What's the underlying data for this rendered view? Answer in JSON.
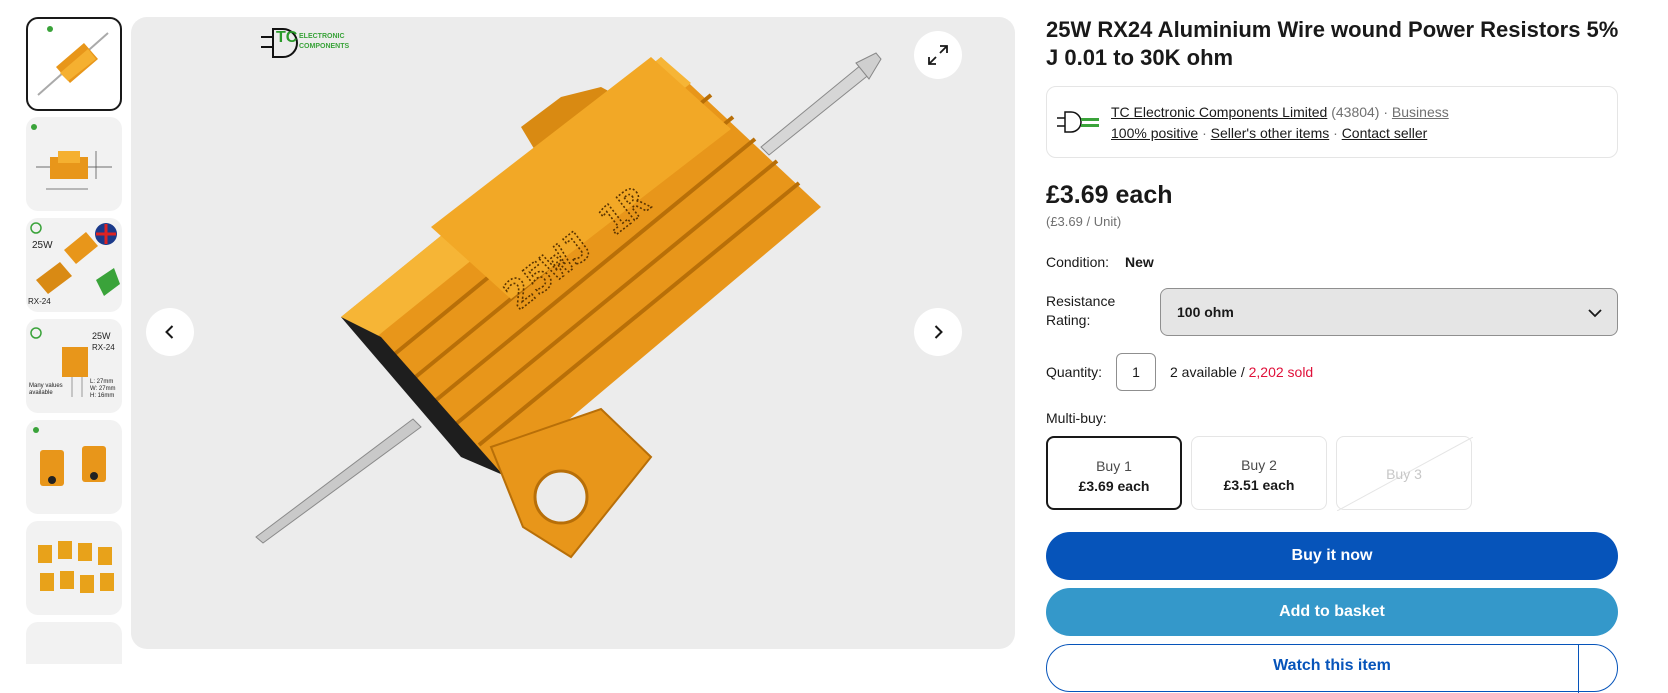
{
  "product": {
    "title": "25W RX24 Aluminium Wire wound Power Resistors 5% J 0.01 to 30K ohm"
  },
  "gallery": {
    "logo_line1": "ELECTRONIC",
    "logo_line2": "COMPONENTS",
    "logo_mark": "TC",
    "resistor_marking": "25WJ 1R",
    "thumbs": [
      {
        "caption": ""
      },
      {
        "caption": ""
      },
      {
        "caption": "25W",
        "caption2": "RX-24"
      },
      {
        "caption": "25W",
        "caption2": "RX-24",
        "caption3": "Many values available",
        "dims": "L: 27mm W: 27mm H: 16mm"
      },
      {
        "caption": ""
      },
      {
        "caption": ""
      }
    ]
  },
  "seller": {
    "name": "TC Electronic Components Limited",
    "feedback_count": "(43804)",
    "dot": "·",
    "type": "Business",
    "positive": "100% positive",
    "other_items": "Seller's other items",
    "contact": "Contact seller"
  },
  "price": {
    "main": "£3.69 each",
    "unit": "(£3.69 / Unit)"
  },
  "condition": {
    "label": "Condition:",
    "value": "New"
  },
  "resistance": {
    "label": "Resistance Rating:",
    "selected": "100 ohm"
  },
  "quantity": {
    "label": "Quantity:",
    "value": "1",
    "available": "2 available /",
    "sold": "2,202 sold"
  },
  "multibuy": {
    "label": "Multi-buy:",
    "tiles": [
      {
        "qty": "Buy 1",
        "price": "£3.69 each",
        "state": "selected"
      },
      {
        "qty": "Buy 2",
        "price": "£3.51 each",
        "state": "normal"
      },
      {
        "qty": "Buy 3",
        "price": "",
        "state": "disabled"
      }
    ]
  },
  "actions": {
    "buy_now": "Buy it now",
    "add_basket": "Add to basket",
    "watch": "Watch this item"
  },
  "colors": {
    "primary_blue": "#0654ba",
    "secondary_blue": "#3498ca",
    "sold_red": "#e0103a",
    "resistor_gold": "#f0a020"
  }
}
